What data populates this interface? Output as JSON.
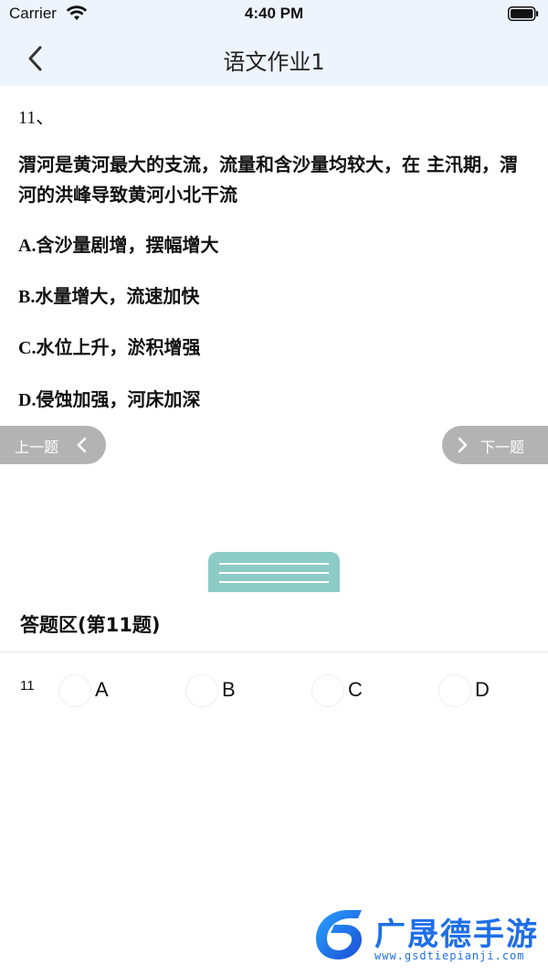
{
  "status_bar": {
    "carrier": "Carrier",
    "time": "4:40 PM"
  },
  "nav": {
    "title": "语文作业1",
    "back_icon": "chevron-left-icon"
  },
  "question": {
    "number": "11、",
    "stem": "渭河是黄河最大的支流，流量和含沙量均较大，在 主汛期，渭河的洪峰导致黄河小北干流",
    "options": [
      {
        "letter": "A.",
        "text": "含沙量剧增，摆幅增大"
      },
      {
        "letter": "B.",
        "text": "水量增大，流速加快"
      },
      {
        "letter": "C.",
        "text": "水位上升，淤积增强"
      },
      {
        "letter": "D.",
        "text": "侵蚀加强，河床加深"
      }
    ]
  },
  "pager": {
    "prev_label": "上一题",
    "next_label": "下一题"
  },
  "answer_area": {
    "title": "答题区(第11题)",
    "row_number": "11",
    "choices": [
      "A",
      "B",
      "C",
      "D"
    ]
  },
  "watermark": {
    "name": "广晟德手游",
    "url": "www.gsdtiepianji.com"
  },
  "colors": {
    "header_bg": "#eef4fb",
    "pager_bg": "#b3b3b3",
    "handle": "#8ccbc6",
    "watermark": "#1f6fe6"
  }
}
